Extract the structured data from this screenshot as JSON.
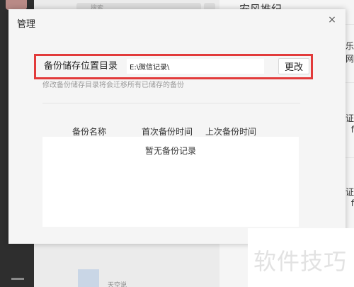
{
  "background": {
    "search_placeholder": "搜索",
    "chat_title": "安风推纪",
    "edge_texts": [
      "音乐",
      "网",
      "证",
      "f",
      "证",
      "f"
    ],
    "list_row_text": "天空说"
  },
  "dialog": {
    "title": "管理",
    "close_symbol": "×",
    "path_label": "备份储存位置目录",
    "path_value": "E:\\微信记录\\",
    "change_button": "更改",
    "hint": "修改备份储存目录将会迁移所有已储存的备份",
    "columns": [
      "备份名称",
      "首次备份时间",
      "上次备份时间"
    ],
    "empty_text": "暂无备份记录"
  },
  "watermark": "软件技巧",
  "colors": {
    "highlight_border": "#e23b3b",
    "dialog_bg": "#f5f5f5",
    "table_bg": "#ffffff"
  }
}
